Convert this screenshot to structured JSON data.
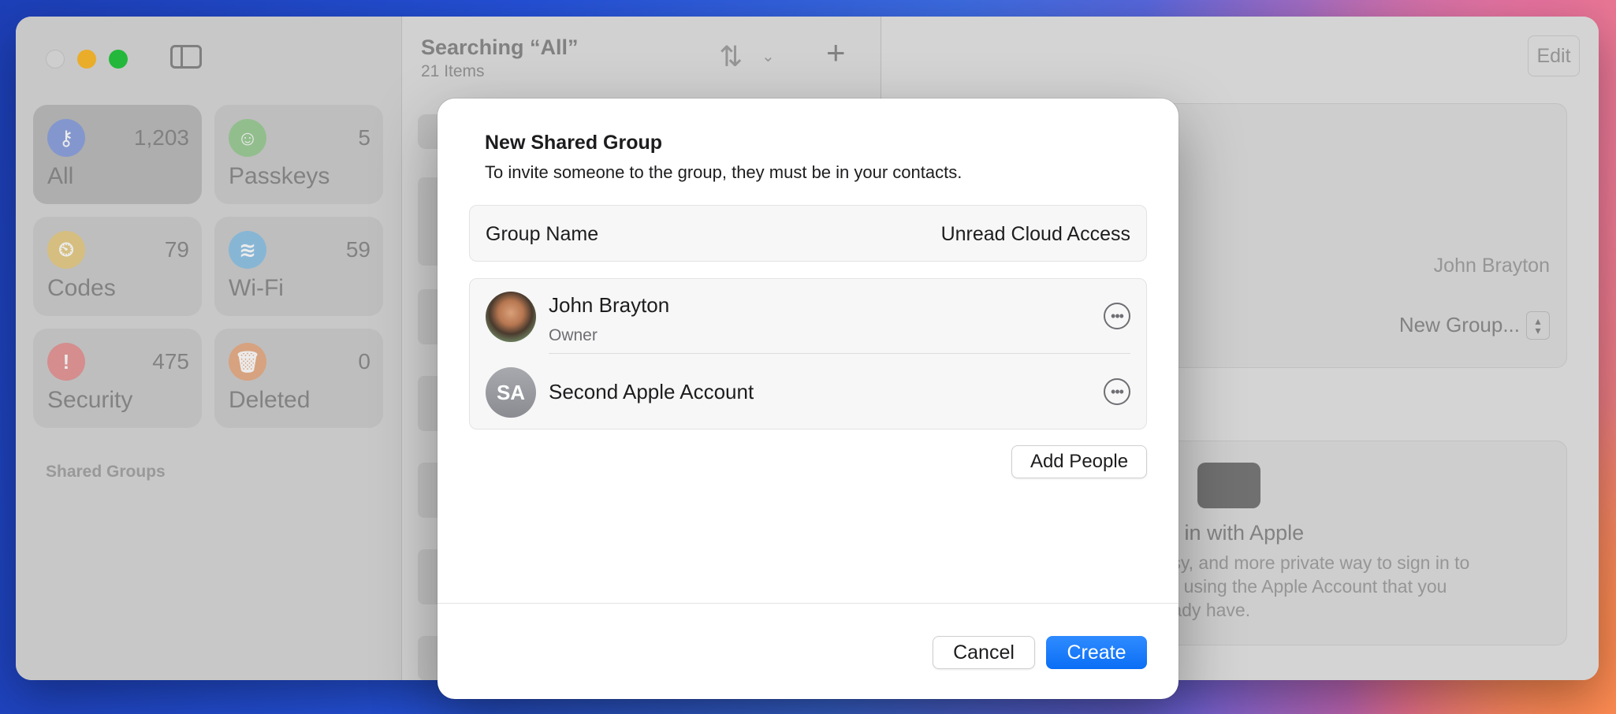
{
  "sidebar": {
    "tiles": [
      {
        "label": "All",
        "count": "1,203",
        "icon": "key-icon",
        "color": "#8fa4e0"
      },
      {
        "label": "Passkeys",
        "count": "5",
        "icon": "person-badge-icon",
        "color": "#9fcf9a"
      },
      {
        "label": "Codes",
        "count": "79",
        "icon": "lock-clock-icon",
        "color": "#e8cf8a"
      },
      {
        "label": "Wi-Fi",
        "count": "59",
        "icon": "wifi-icon",
        "color": "#93c6e8"
      },
      {
        "label": "Security",
        "count": "475",
        "icon": "exclamation-icon",
        "color": "#e89a9a"
      },
      {
        "label": "Deleted",
        "count": "0",
        "icon": "trash-icon",
        "color": "#eab08a"
      }
    ],
    "section_label": "Shared Groups"
  },
  "list": {
    "title": "Searching “All”",
    "subtitle": "21 Items"
  },
  "detail": {
    "edit_label": "Edit",
    "owner_value": "John Brayton",
    "group_value": "New Group...",
    "siwa_title": "n in with Apple",
    "siwa_desc": ", easy, and more private way to sign in to\nsites using the Apple Account that you\nalready have."
  },
  "sheet": {
    "title": "New Shared Group",
    "subtitle": "To invite someone to the group, they must be in your contacts.",
    "group_name_label": "Group Name",
    "group_name_value": "Unread Cloud Access",
    "members": [
      {
        "name": "John Brayton",
        "role": "Owner"
      },
      {
        "name": "Second Apple Account",
        "initials": "SA"
      }
    ],
    "add_people_label": "Add People",
    "cancel_label": "Cancel",
    "create_label": "Create"
  },
  "colors": {
    "accent": "#0a6ef5"
  }
}
